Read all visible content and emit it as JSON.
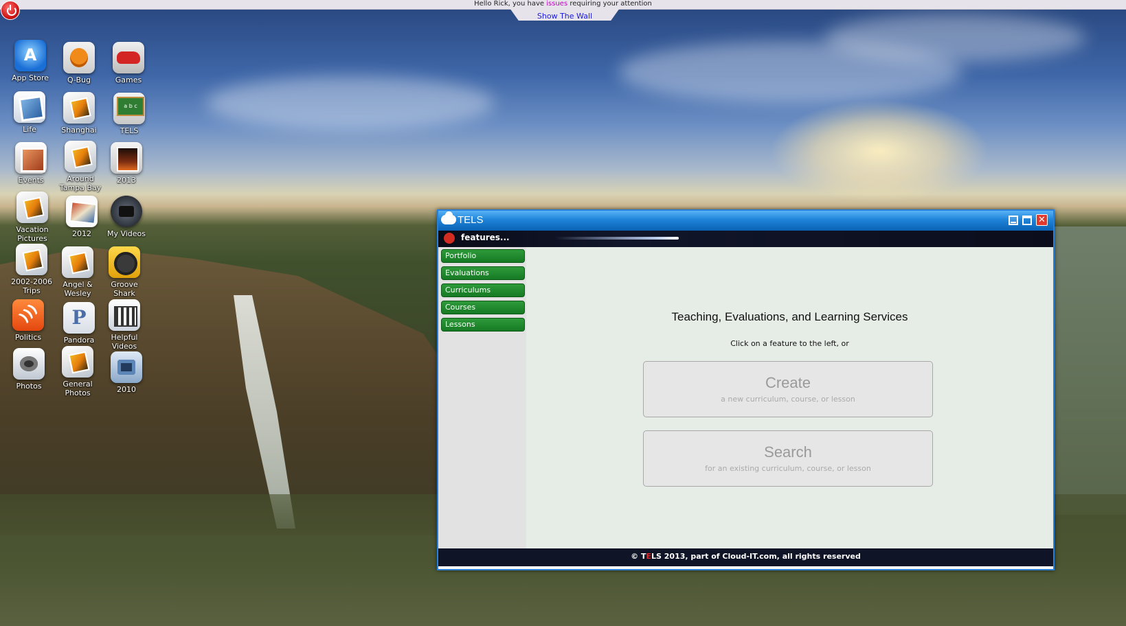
{
  "topbar": {
    "greeting_prefix": "Hello Rick, you have ",
    "issues_link": "issues",
    "greeting_suffix": " requiring your attention",
    "show_wall": "Show The Wall"
  },
  "desktop_icons": [
    {
      "label": "App Store",
      "icon": "app-store-icon"
    },
    {
      "label": "Q-Bug",
      "icon": "ladybug-icon"
    },
    {
      "label": "Games",
      "icon": "race-car-icon"
    },
    {
      "label": "Life",
      "icon": "photo-icon"
    },
    {
      "label": "Shanghai",
      "icon": "photo-icon"
    },
    {
      "label": "TELS",
      "icon": "chalkboard-icon"
    },
    {
      "label": "Events",
      "icon": "photo-icon"
    },
    {
      "label": "Around Tampa Bay",
      "icon": "photo-icon"
    },
    {
      "label": "2013",
      "icon": "photo-icon"
    },
    {
      "label": "Vacation Pictures",
      "icon": "photo-icon"
    },
    {
      "label": "2012",
      "icon": "photo-icon"
    },
    {
      "label": "My Videos",
      "icon": "video-camera-icon"
    },
    {
      "label": "2002-2006 Trips",
      "icon": "photo-icon"
    },
    {
      "label": "Angel & Wesley",
      "icon": "photo-icon"
    },
    {
      "label": "Groove Shark",
      "icon": "headphones-icon"
    },
    {
      "label": "Politics",
      "icon": "rss-icon"
    },
    {
      "label": "Pandora",
      "icon": "pandora-icon"
    },
    {
      "label": "Helpful Videos",
      "icon": "clapperboard-icon"
    },
    {
      "label": "Photos",
      "icon": "camera-icon"
    },
    {
      "label": "General Photos",
      "icon": "photo-icon"
    },
    {
      "label": "2010",
      "icon": "camera-icon"
    }
  ],
  "window": {
    "title": "TELS",
    "features_label": "features...",
    "nav": [
      "Portfolio",
      "Evaluations",
      "Curriculums",
      "Courses",
      "Lessons"
    ],
    "heading": "Teaching, Evaluations, and Learning Services",
    "subheading": "Click on a feature to the left, or",
    "create": {
      "title": "Create",
      "subtitle": "a new curriculum, course, or lesson"
    },
    "search": {
      "title": "Search",
      "subtitle": "for an existing curriculum, course, or lesson"
    },
    "footer": {
      "prefix": "© T",
      "red": "E",
      "suffix": "LS 2013, part of Cloud-IT.com, all rights reserved"
    }
  }
}
